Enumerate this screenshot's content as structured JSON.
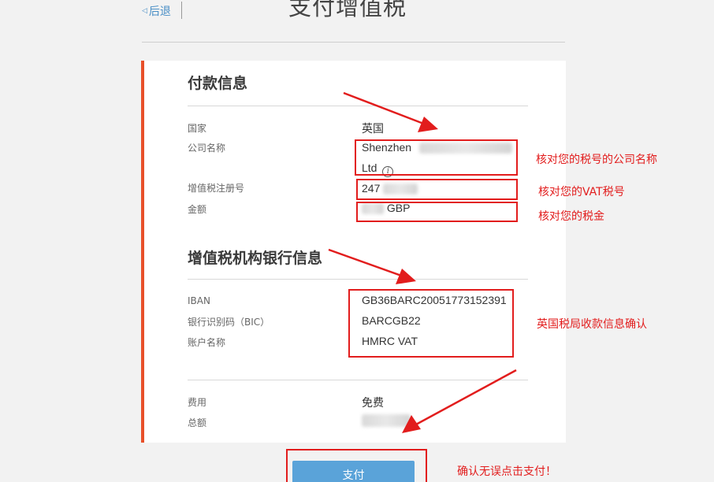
{
  "header": {
    "back_label": "后退",
    "title": "支付增值税"
  },
  "payment_info": {
    "title": "付款信息",
    "rows": [
      {
        "label": "国家",
        "value": "英国"
      },
      {
        "label": "公司名称",
        "value_line1": "Shenzhen",
        "value_line2": "Ltd"
      },
      {
        "label": "增值税注册号",
        "value": "247"
      },
      {
        "label": "金额",
        "value": "GBP"
      }
    ]
  },
  "bank_info": {
    "title": "增值税机构银行信息",
    "rows": [
      {
        "label": "IBAN",
        "value": "GB36BARC20051773152391"
      },
      {
        "label": "银行识别码（BIC）",
        "value": "BARCGB22"
      },
      {
        "label": "账户名称",
        "value": "HMRC VAT"
      }
    ]
  },
  "fees": {
    "rows": [
      {
        "label": "费用",
        "value": "免费"
      },
      {
        "label": "总额",
        "value": ""
      }
    ]
  },
  "pay_button": {
    "label": "支付"
  },
  "annotations": {
    "company_name": "核对您的税号的公司名称",
    "vat_number": "核对您的VAT税号",
    "amount": "核对您的税金",
    "bank": "英国税局收款信息确认",
    "pay": "确认无误点击支付！"
  },
  "colors": {
    "accent": "#e8502a",
    "annotation": "#e21d1d",
    "button": "#5aa3d9",
    "link": "#4a8fc6"
  }
}
